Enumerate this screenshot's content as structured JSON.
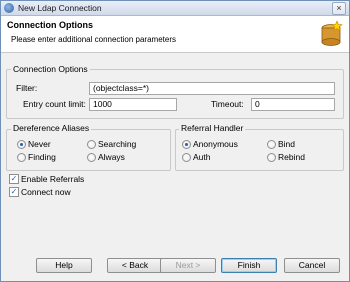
{
  "window": {
    "title": "New Ldap Connection",
    "close_glyph": "×"
  },
  "header": {
    "title": "Connection Options",
    "subtitle": "Please enter additional connection parameters",
    "icon": "database-star-icon"
  },
  "connection_options": {
    "group_title": "Connection Options",
    "filter_label": "Filter:",
    "filter_value": "(objectclass=*)",
    "entry_limit_label": "Entry count limit:",
    "entry_limit_value": "1000",
    "timeout_label": "Timeout:",
    "timeout_value": "0"
  },
  "dereference": {
    "group_title": "Dereference Aliases",
    "options": [
      {
        "label": "Never",
        "selected": true
      },
      {
        "label": "Searching",
        "selected": false
      },
      {
        "label": "Finding",
        "selected": false
      },
      {
        "label": "Always",
        "selected": false
      }
    ]
  },
  "referral": {
    "group_title": "Referral Handler",
    "options": [
      {
        "label": "Anonymous",
        "selected": true
      },
      {
        "label": "Bind",
        "selected": false
      },
      {
        "label": "Auth",
        "selected": false
      },
      {
        "label": "Rebind",
        "selected": false
      }
    ]
  },
  "checks": {
    "enable_referrals": {
      "label": "Enable Referrals",
      "checked": true
    },
    "connect_now": {
      "label": "Connect now",
      "checked": true
    }
  },
  "buttons": {
    "help": "Help",
    "back": "< Back",
    "next": "Next >",
    "finish": "Finish",
    "cancel": "Cancel"
  }
}
